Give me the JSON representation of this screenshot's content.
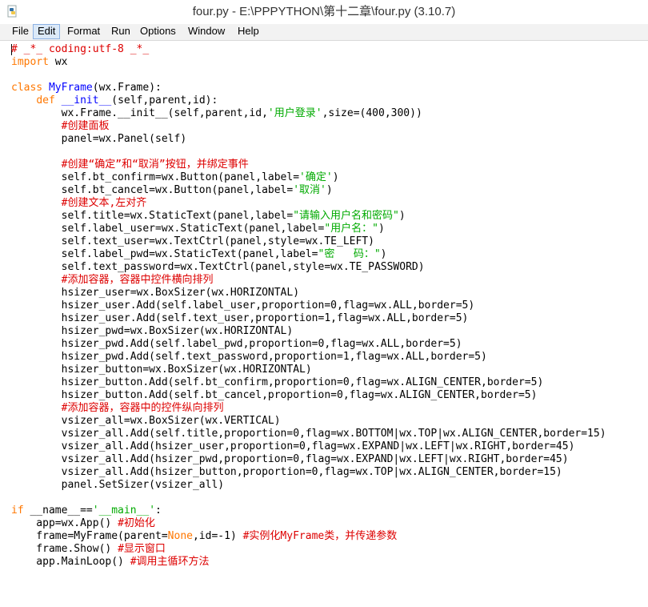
{
  "window": {
    "title": "four.py - E:\\PPPYTHON\\第十二章\\four.py (3.10.7)",
    "icon": "python-file-icon"
  },
  "menu": {
    "items": [
      "File",
      "Edit",
      "Format",
      "Run",
      "Options",
      "Window",
      "Help"
    ],
    "active": "Edit"
  },
  "editor": {
    "lines": [
      [
        {
          "t": "# _*_ coding:utf-8 _*_",
          "c": "cm"
        }
      ],
      [
        {
          "t": "import",
          "c": "kw"
        },
        {
          "t": " wx"
        }
      ],
      [],
      [
        {
          "t": "class",
          "c": "kw"
        },
        {
          "t": " "
        },
        {
          "t": "MyFrame",
          "c": "df"
        },
        {
          "t": "(wx.Frame):"
        }
      ],
      [
        {
          "t": "    "
        },
        {
          "t": "def",
          "c": "kw"
        },
        {
          "t": " "
        },
        {
          "t": "__init__",
          "c": "df"
        },
        {
          "t": "(self,parent,id):"
        }
      ],
      [
        {
          "t": "        wx.Frame.__init__(self,parent,id,"
        },
        {
          "t": "'用户登录'",
          "c": "st"
        },
        {
          "t": ",size=(400,300))"
        }
      ],
      [
        {
          "t": "        "
        },
        {
          "t": "#创建面板",
          "c": "cm"
        }
      ],
      [
        {
          "t": "        panel=wx.Panel(self)"
        }
      ],
      [],
      [
        {
          "t": "        "
        },
        {
          "t": "#创建“确定”和“取消”按钮，并绑定事件",
          "c": "cm"
        }
      ],
      [
        {
          "t": "        self.bt_confirm=wx.Button(panel,label="
        },
        {
          "t": "'确定'",
          "c": "st"
        },
        {
          "t": ")"
        }
      ],
      [
        {
          "t": "        self.bt_cancel=wx.Button(panel,label="
        },
        {
          "t": "'取消'",
          "c": "st"
        },
        {
          "t": ")"
        }
      ],
      [
        {
          "t": "        "
        },
        {
          "t": "#创建文本,左对齐",
          "c": "cm"
        }
      ],
      [
        {
          "t": "        self.title=wx.StaticText(panel,label="
        },
        {
          "t": "\"请输入用户名和密码\"",
          "c": "st"
        },
        {
          "t": ")"
        }
      ],
      [
        {
          "t": "        self.label_user=wx.StaticText(panel,label="
        },
        {
          "t": "\"用户名：\"",
          "c": "st"
        },
        {
          "t": ")"
        }
      ],
      [
        {
          "t": "        self.text_user=wx.TextCtrl(panel,style=wx.TE_LEFT)"
        }
      ],
      [
        {
          "t": "        self.label_pwd=wx.StaticText(panel,label="
        },
        {
          "t": "\"密   码：\"",
          "c": "st"
        },
        {
          "t": ")"
        }
      ],
      [
        {
          "t": "        self.text_password=wx.TextCtrl(panel,style=wx.TE_PASSWORD)"
        }
      ],
      [
        {
          "t": "        "
        },
        {
          "t": "#添加容器，容器中控件横向排列",
          "c": "cm"
        }
      ],
      [
        {
          "t": "        hsizer_user=wx.BoxSizer(wx.HORIZONTAL)"
        }
      ],
      [
        {
          "t": "        hsizer_user.Add(self.label_user,proportion=0,flag=wx.ALL,border=5)"
        }
      ],
      [
        {
          "t": "        hsizer_user.Add(self.text_user,proportion=1,flag=wx.ALL,border=5)"
        }
      ],
      [
        {
          "t": "        hsizer_pwd=wx.BoxSizer(wx.HORIZONTAL)"
        }
      ],
      [
        {
          "t": "        hsizer_pwd.Add(self.label_pwd,proportion=0,flag=wx.ALL,border=5)"
        }
      ],
      [
        {
          "t": "        hsizer_pwd.Add(self.text_password,proportion=1,flag=wx.ALL,border=5)"
        }
      ],
      [
        {
          "t": "        hsizer_button=wx.BoxSizer(wx.HORIZONTAL)"
        }
      ],
      [
        {
          "t": "        hsizer_button.Add(self.bt_confirm,proportion=0,flag=wx.ALIGN_CENTER,border=5)"
        }
      ],
      [
        {
          "t": "        hsizer_button.Add(self.bt_cancel,proportion=0,flag=wx.ALIGN_CENTER,border=5)"
        }
      ],
      [
        {
          "t": "        "
        },
        {
          "t": "#添加容器，容器中的控件纵向排列",
          "c": "cm"
        }
      ],
      [
        {
          "t": "        vsizer_all=wx.BoxSizer(wx.VERTICAL)"
        }
      ],
      [
        {
          "t": "        vsizer_all.Add(self.title,proportion=0,flag=wx.BOTTOM|wx.TOP|wx.ALIGN_CENTER,border=15)"
        }
      ],
      [
        {
          "t": "        vsizer_all.Add(hsizer_user,proportion=0,flag=wx.EXPAND|wx.LEFT|wx.RIGHT,border=45)"
        }
      ],
      [
        {
          "t": "        vsizer_all.Add(hsizer_pwd,proportion=0,flag=wx.EXPAND|wx.LEFT|wx.RIGHT,border=45)"
        }
      ],
      [
        {
          "t": "        vsizer_all.Add(hsizer_button,proportion=0,flag=wx.TOP|wx.ALIGN_CENTER,border=15)"
        }
      ],
      [
        {
          "t": "        panel.SetSizer(vsizer_all)"
        }
      ],
      [],
      [
        {
          "t": "if",
          "c": "kw"
        },
        {
          "t": " __name__=="
        },
        {
          "t": "'__main__'",
          "c": "st"
        },
        {
          "t": ":"
        }
      ],
      [
        {
          "t": "    app=wx.App() "
        },
        {
          "t": "#初始化",
          "c": "cm"
        }
      ],
      [
        {
          "t": "    frame=MyFrame(parent="
        },
        {
          "t": "None",
          "c": "kw"
        },
        {
          "t": ",id=-1) "
        },
        {
          "t": "#实例化MyFrame类，并传递参数",
          "c": "cm"
        }
      ],
      [
        {
          "t": "    frame.Show() "
        },
        {
          "t": "#显示窗口",
          "c": "cm"
        }
      ],
      [
        {
          "t": "    app.MainLoop() "
        },
        {
          "t": "#调用主循环方法",
          "c": "cm"
        }
      ]
    ]
  }
}
